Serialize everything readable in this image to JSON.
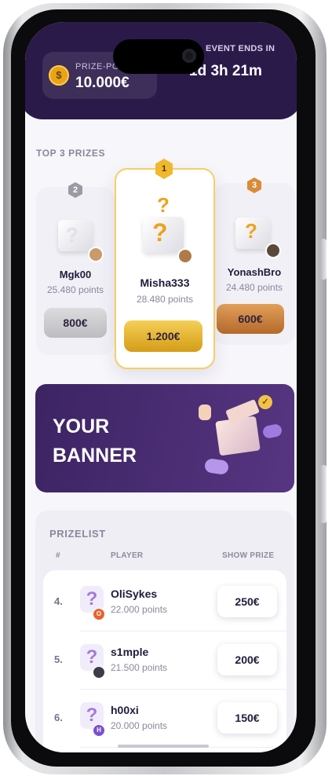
{
  "header": {
    "prize_pool_label": "PRIZE-POOL",
    "prize_pool_value": "10.000€",
    "coin_symbol": "$",
    "event_ends_label": "EVENT ENDS IN",
    "event_ends_value": "1d 3h 21m"
  },
  "top3": {
    "title": "TOP 3 PRIZES",
    "first": {
      "rank": "1",
      "name": "Misha333",
      "points": "28.480 points",
      "prize": "1.200€",
      "color": "#f0b82b"
    },
    "second": {
      "rank": "2",
      "name": "Mgk00",
      "points": "25.480 points",
      "prize": "800€",
      "color": "#c9c9cc"
    },
    "third": {
      "rank": "3",
      "name": "YonashBro",
      "points": "24.480 points",
      "prize": "600€",
      "color": "#d98b3a"
    }
  },
  "banner": {
    "text": "YOUR\nBANNER"
  },
  "prizelist": {
    "title": "PRIZELIST",
    "col_rank": "#",
    "col_player": "PLAYER",
    "col_prize": "SHOW PRIZE",
    "rows": [
      {
        "rank": "4.",
        "name": "OliSykes",
        "points": "22.000 points",
        "prize": "250€",
        "avatar_letter": "O",
        "avatar_color": "#e8632b"
      },
      {
        "rank": "5.",
        "name": "s1mple",
        "points": "21.500 points",
        "prize": "200€",
        "avatar_letter": "",
        "avatar_color": "#3b3b4a"
      },
      {
        "rank": "6.",
        "name": "h00xi",
        "points": "20.000 points",
        "prize": "150€",
        "avatar_letter": "H",
        "avatar_color": "#7a4fd6"
      }
    ]
  }
}
